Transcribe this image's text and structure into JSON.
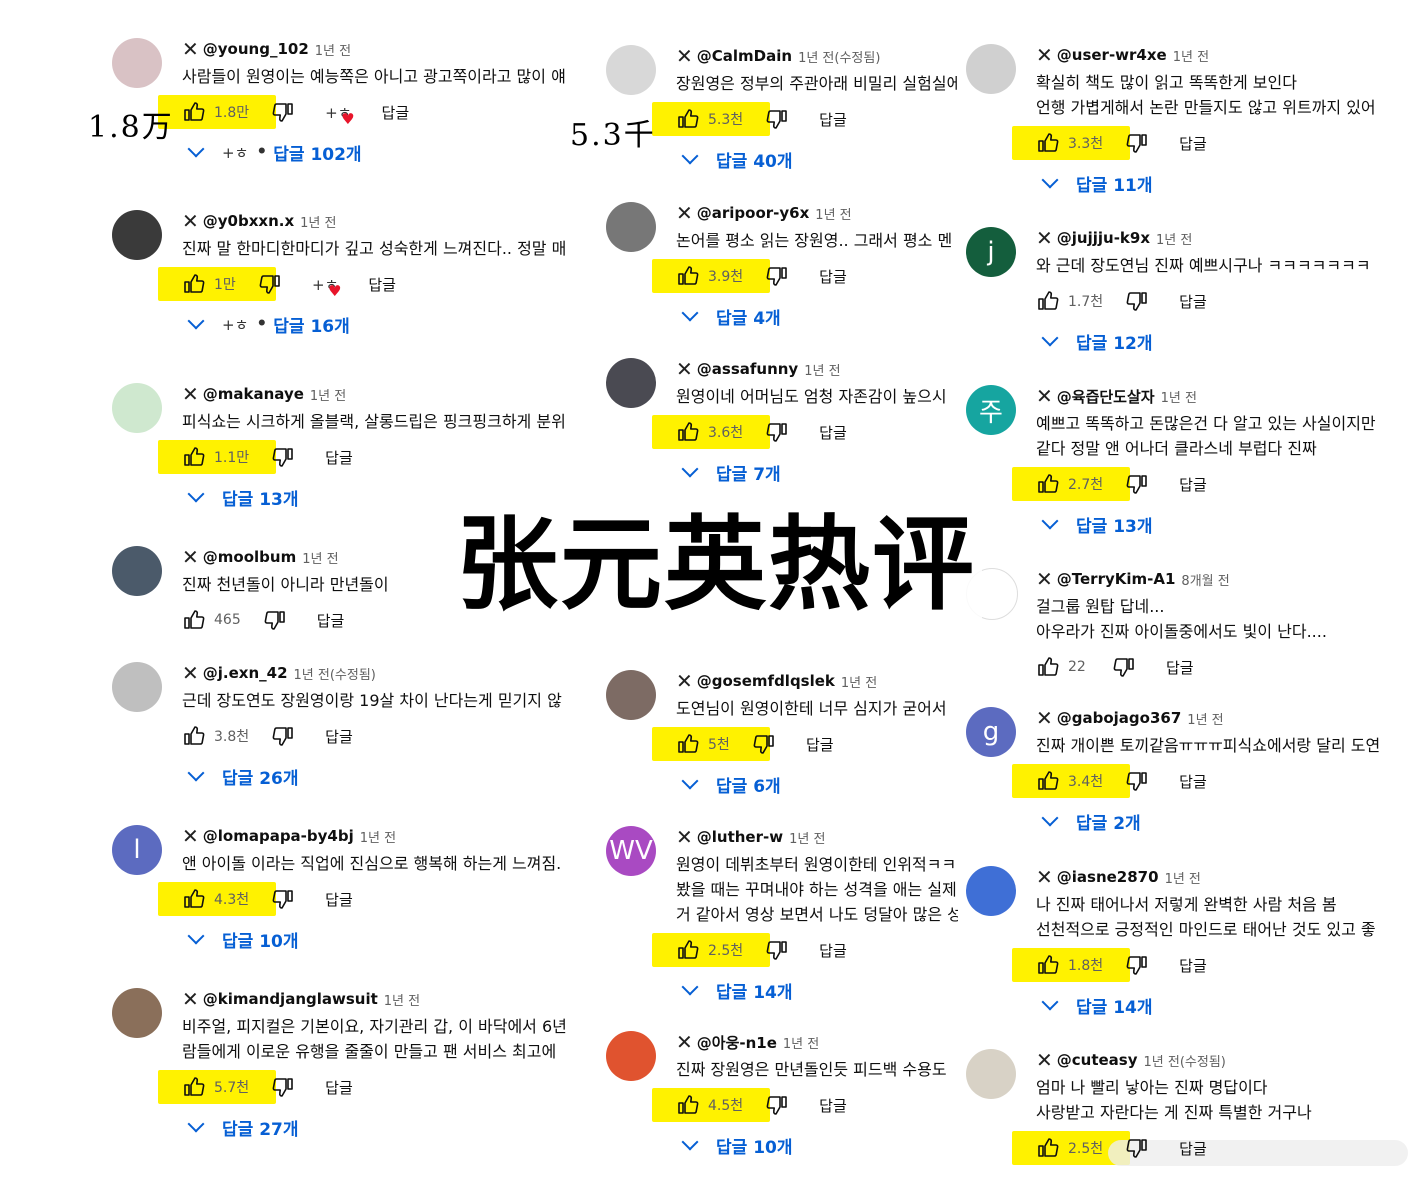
{
  "overlay": {
    "title": "张元英热评",
    "annotation_left": "1.8万",
    "annotation_mid": "5.3千"
  },
  "labels": {
    "reply": "답글"
  },
  "colors": {
    "highlight": "#fff200",
    "link": "#065fd4"
  },
  "columns": [
    {
      "comments": [
        {
          "handle": "@young_102",
          "time": "1년 전",
          "avatar_letter": "",
          "avatar_color": "#d9c2c5",
          "text": [
            "사람들이 원영이는 예능쪽은 아니고 광고쪽이라고 많이 얘"
          ],
          "likes": "1.8만",
          "highlight": true,
          "heart": true,
          "replies": "답글 102개"
        },
        {
          "handle": "@y0bxxn.x",
          "time": "1년 전",
          "avatar_letter": "",
          "avatar_color": "#3a3a3a",
          "text": [
            "진짜 말 한마디한마디가 깊고 성숙한게 느껴진다.. 정말 매"
          ],
          "likes": "1만",
          "highlight": true,
          "heart": true,
          "replies": "답글 16개"
        },
        {
          "handle": "@makanaye",
          "time": "1년 전",
          "avatar_letter": "",
          "avatar_color": "#cfe8cf",
          "text": [
            "피식쇼는 시크하게 올블랙, 살롱드립은 핑크핑크하게 분위"
          ],
          "likes": "1.1만",
          "highlight": true,
          "heart": false,
          "replies": "답글 13개"
        },
        {
          "handle": "@moolbum",
          "time": "1년 전",
          "avatar_letter": "",
          "avatar_color": "#4b5a6a",
          "text": [
            "진짜 천년돌이 아니라 만년돌이"
          ],
          "likes": "465",
          "highlight": false,
          "heart": false,
          "replies": ""
        },
        {
          "handle": "@j.exn_42",
          "time": "1년 전(수정됨)",
          "avatar_letter": "",
          "avatar_color": "#bfbfbf",
          "text": [
            "근데 장도연도 장원영이랑 19살 차이 난다는게 믿기지 않"
          ],
          "likes": "3.8천",
          "highlight": false,
          "heart": false,
          "replies": "답글 26개"
        },
        {
          "handle": "@lomapapa-by4bj",
          "time": "1년 전",
          "avatar_letter": "l",
          "avatar_color": "#5c6bc0",
          "text": [
            "앤 아이돌 이라는 직업에 진심으로 행복해 하는게 느껴짐."
          ],
          "likes": "4.3천",
          "highlight": true,
          "heart": false,
          "replies": "답글 10개"
        },
        {
          "handle": "@kimandjanglawsuit",
          "time": "1년 전",
          "avatar_letter": "",
          "avatar_color": "#8a6f5a",
          "text": [
            "비주얼, 피지컬은 기본이요, 자기관리 갑, 이 바닥에서 6년",
            "람들에게 이로운 유행을 줄줄이 만들고 팬 서비스 최고에"
          ],
          "likes": "5.7천",
          "highlight": true,
          "heart": false,
          "replies": "답글 27개"
        }
      ]
    },
    {
      "comments": [
        {
          "handle": "@CalmDain",
          "time": "1년 전(수정됨)",
          "avatar_letter": "",
          "avatar_color": "#d8d8d8",
          "text": [
            "장원영은 정부의 주관아래 비밀리 실험실에"
          ],
          "likes": "5.3천",
          "highlight": true,
          "heart": false,
          "replies": "답글 40개"
        },
        {
          "handle": "@aripoor-y6x",
          "time": "1년 전",
          "avatar_letter": "",
          "avatar_color": "#777777",
          "text": [
            "논어를 평소 읽는 장원영.. 그래서 평소 멘"
          ],
          "likes": "3.9천",
          "highlight": true,
          "heart": false,
          "replies": "답글 4개"
        },
        {
          "handle": "@assafunny",
          "time": "1년 전",
          "avatar_letter": "",
          "avatar_color": "#4a4a52",
          "text": [
            "원영이네 어머님도 엄청 자존감이 높으시"
          ],
          "likes": "3.6천",
          "highlight": true,
          "heart": false,
          "replies": "답글 7개"
        },
        {
          "handle": "@gosemfdlqslek",
          "time": "1년 전",
          "avatar_letter": "",
          "avatar_color": "#7d6b64",
          "text": [
            "도연님이 원영이한테 너무 심지가 굳어서"
          ],
          "likes": "5천",
          "highlight": true,
          "heart": false,
          "replies": "답글 6개"
        },
        {
          "handle": "@luther-w",
          "time": "1년 전",
          "avatar_letter": "WV",
          "avatar_color": "#a94ac2",
          "text": [
            "원영이 데뷔초부터 원영이한테 인위적ㅋㅋ",
            "봤을 때는 꾸며내야 하는 성격을 애는 실제",
            "거 같아서 영상 보면서 나도 덩달아 많은 성"
          ],
          "likes": "2.5천",
          "highlight": true,
          "heart": false,
          "replies": "답글 14개"
        },
        {
          "handle": "@아웅-n1e",
          "time": "1년 전",
          "avatar_letter": "",
          "avatar_color": "#e0532f",
          "text": [
            "진짜 장원영은 만년돌인듯 피드백 수용도"
          ],
          "likes": "4.5천",
          "highlight": true,
          "heart": false,
          "replies": "답글 10개"
        }
      ]
    },
    {
      "comments": [
        {
          "handle": "@user-wr4xe",
          "time": "1년 전",
          "avatar_letter": "",
          "avatar_color": "#d0d0d0",
          "text": [
            "확실히 책도 많이 읽고 똑똑한게 보인다",
            "언행 가볍게해서 논란 만들지도 않고 위트까지 있어"
          ],
          "likes": "3.3천",
          "highlight": true,
          "heart": false,
          "replies": "답글 11개"
        },
        {
          "handle": "@jujjju-k9x",
          "time": "1년 전",
          "avatar_letter": "j",
          "avatar_color": "#145e3d",
          "text": [
            "와 근데 장도연님 진짜 예쁘시구나 ㅋㅋㅋㅋㅋㅋㅋ"
          ],
          "likes": "1.7천",
          "highlight": false,
          "heart": false,
          "replies": "답글 12개"
        },
        {
          "handle": "@육즙단도살자",
          "time": "1년 전",
          "avatar_letter": "주",
          "avatar_color": "#16a5a0",
          "text": [
            "예쁘고 똑똑하고 돈많은건 다 알고 있는 사실이지만",
            "같다 정말 앤 어나더 클라스네 부럽다 진짜"
          ],
          "likes": "2.7천",
          "highlight": true,
          "heart": false,
          "replies": "답글 13개"
        },
        {
          "handle": "@TerryKim-A1",
          "time": "8개월 전",
          "avatar_letter": "",
          "avatar_color": "",
          "text": [
            "걸그룹 원탑 답네...",
            "아우라가 진짜 아이돌중에서도 빛이 난다...."
          ],
          "likes": "22",
          "highlight": false,
          "heart": false,
          "replies": ""
        },
        {
          "handle": "@gabojago367",
          "time": "1년 전",
          "avatar_letter": "g",
          "avatar_color": "#5c6bc0",
          "text": [
            "진짜 개이쁜 토끼같음ㅠㅠㅠ피식쇼에서랑 달리 도연"
          ],
          "likes": "3.4천",
          "highlight": true,
          "heart": false,
          "replies": "답글 2개"
        },
        {
          "handle": "@iasne2870",
          "time": "1년 전",
          "avatar_letter": "",
          "avatar_color": "#3f6fd6",
          "text": [
            "나 진짜 태어나서 저렇게 완벽한 사람 처음 봄",
            "선천적으로 긍정적인 마인드로 태어난 것도 있고 좋"
          ],
          "likes": "1.8천",
          "highlight": true,
          "heart": false,
          "replies": "답글 14개"
        },
        {
          "handle": "@cuteasy",
          "time": "1년 전(수정됨)",
          "avatar_letter": "",
          "avatar_color": "#d8d2c6",
          "text": [
            "엄마 나 빨리 낳아는 진짜 명답이다",
            "사랑받고 자란다는 게 진짜 특별한 거구나"
          ],
          "likes": "2.5천",
          "highlight": true,
          "heart": false,
          "replies": ""
        }
      ]
    }
  ]
}
